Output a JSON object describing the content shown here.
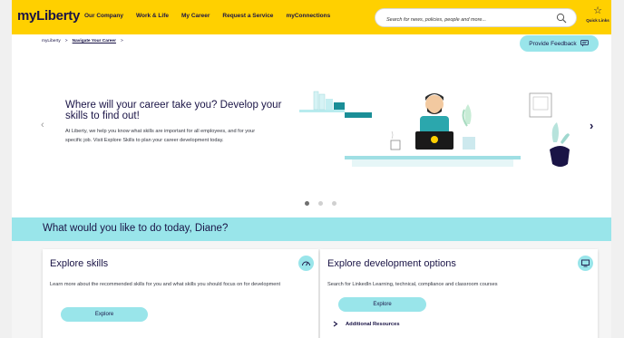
{
  "header": {
    "logo": "myLiberty",
    "nav": [
      "Our Company",
      "Work & Life",
      "My Career",
      "Request a Service",
      "myConnections"
    ],
    "search_placeholder": "Search for news, policies, people and more...",
    "quick_links": "Quick Links",
    "icons": {
      "search": "search-icon",
      "quick_links": "star-icon"
    }
  },
  "breadcrumb": {
    "root": "myLiberty",
    "sep1": ">",
    "current": "Navigate Your Career",
    "sep2": ">"
  },
  "feedback": {
    "label": "Provide Feedback",
    "icon": "chat-icon"
  },
  "hero": {
    "title": "Where will your career take you? Develop your skills to find out!",
    "body": "At Liberty, we help you know what skills are important for all employees, and for your specific job. Visit Explore Skills to plan your career development today.",
    "prev": "‹",
    "next": "›",
    "slides_count": 3,
    "active_slide": 1
  },
  "band": {
    "title": "What would you like to do today, Diane?"
  },
  "cards": [
    {
      "title": "Explore skills",
      "description": "Learn more about the recommended skills for you and what skills you should focus on for development",
      "button": "Explore",
      "icon": "gauge-icon"
    },
    {
      "title": "Explore development options",
      "description": "Search for LinkedIn Learning, technical, compliance and classroom courses",
      "button": "Explore",
      "link": "Additional Resources",
      "icon": "monitor-icon"
    }
  ],
  "colors": {
    "brand_yellow": "#ffd000",
    "navy": "#1a1446",
    "teal": "#99e5ea"
  }
}
